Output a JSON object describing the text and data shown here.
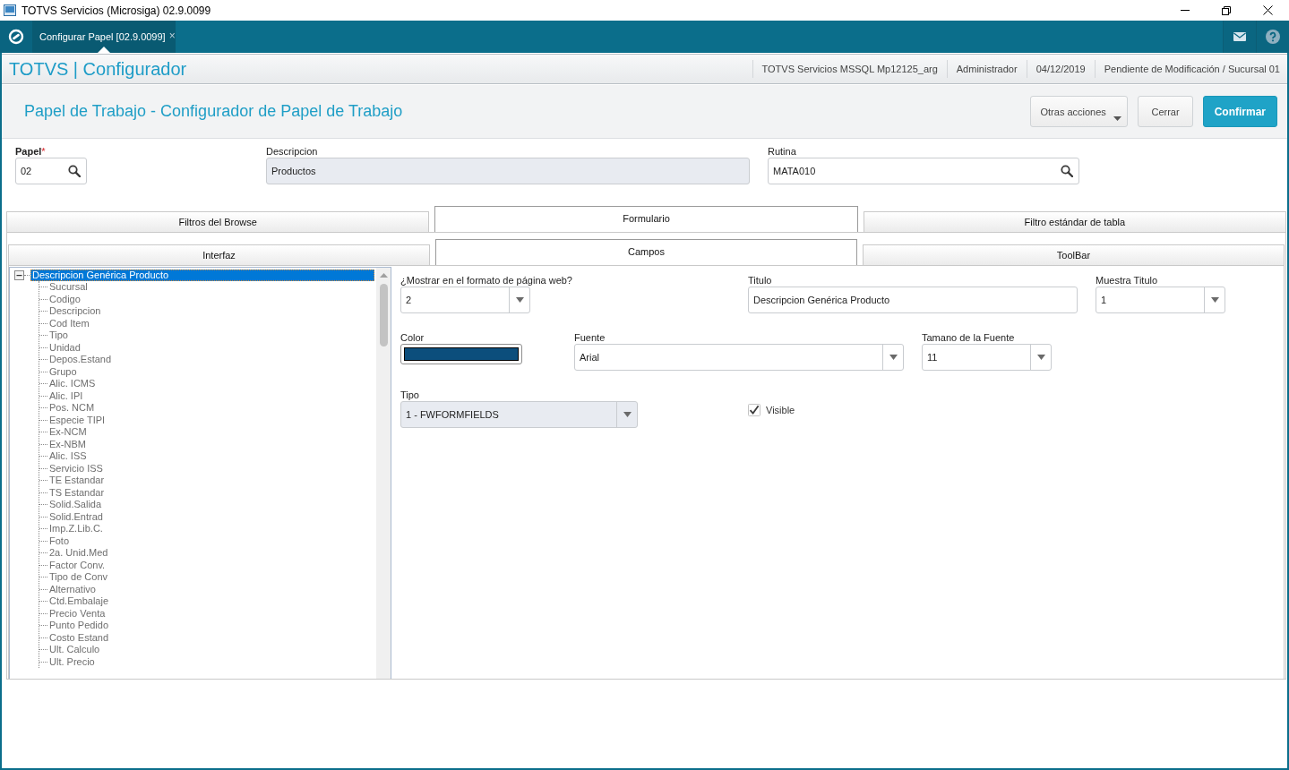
{
  "window": {
    "title": "TOTVS Servicios (Microsiga) 02.9.0099"
  },
  "app_bar": {
    "tabs": [
      {
        "label": "Configurar Papel [02.9.0099]",
        "close": "×",
        "selected": true
      }
    ]
  },
  "header": {
    "brand": "TOTVS | Configurador",
    "info": [
      "TOTVS Servicios MSSQL Mp12125_arg",
      "Administrador",
      "04/12/2019",
      "Pendiente de Modificación / Sucursal 01"
    ]
  },
  "page": {
    "title": "Papel de Trabajo - Configurador de Papel de Trabajo",
    "actions": [
      {
        "label": "Otras acciones",
        "kind": "menu"
      },
      {
        "label": "Cerrar",
        "kind": "secondary"
      },
      {
        "label": "Confirmar",
        "kind": "primary"
      }
    ]
  },
  "fields": [
    {
      "label": "Papel",
      "required_mark": "*",
      "kind": "lookup",
      "value": "02",
      "disabled": false
    },
    {
      "label": "Descripcion",
      "kind": "text",
      "value": "Productos",
      "disabled": true
    },
    {
      "label": "Rutina",
      "kind": "lookup",
      "value": "MATA010",
      "disabled": false
    }
  ],
  "tabs": [
    {
      "label": "Filtros del Browse",
      "selected": false
    },
    {
      "label": "Formulario",
      "selected": true
    },
    {
      "label": "Filtro estándar de tabla",
      "selected": false
    }
  ],
  "subtabs": [
    {
      "label": "Interfaz",
      "selected": false
    },
    {
      "label": "Campos",
      "selected": true
    },
    {
      "label": "ToolBar",
      "selected": false
    }
  ],
  "tree": {
    "items": [
      {
        "label": "Descripcion Genérica Producto",
        "selected": true,
        "expanded": true,
        "children": [
          {
            "label": "Sucursal",
            "selected": false
          },
          {
            "label": "Codigo",
            "selected": false
          },
          {
            "label": "Descripcion",
            "selected": false
          },
          {
            "label": "Cod Item",
            "selected": false
          },
          {
            "label": "Tipo",
            "selected": false
          },
          {
            "label": "Unidad",
            "selected": false
          },
          {
            "label": "Depos.Estand",
            "selected": false
          },
          {
            "label": "Grupo",
            "selected": false
          },
          {
            "label": "Alic. ICMS",
            "selected": false
          },
          {
            "label": "Alic. IPI",
            "selected": false
          },
          {
            "label": "Pos. NCM",
            "selected": false
          },
          {
            "label": "Especie TIPI",
            "selected": false
          },
          {
            "label": "Ex-NCM",
            "selected": false
          },
          {
            "label": "Ex-NBM",
            "selected": false
          },
          {
            "label": "Alic. ISS",
            "selected": false
          },
          {
            "label": "Servicio ISS",
            "selected": false
          },
          {
            "label": "TE Estandar",
            "selected": false
          },
          {
            "label": "TS Estandar",
            "selected": false
          },
          {
            "label": "Solid.Salida",
            "selected": false
          },
          {
            "label": "Solid.Entrad",
            "selected": false
          },
          {
            "label": "Imp.Z.Lib.C.",
            "selected": false
          },
          {
            "label": "Foto",
            "selected": false
          },
          {
            "label": "2a. Unid.Med",
            "selected": false
          },
          {
            "label": "Factor Conv.",
            "selected": false
          },
          {
            "label": "Tipo de Conv",
            "selected": false
          },
          {
            "label": "Alternativo",
            "selected": false
          },
          {
            "label": "Ctd.Embalaje",
            "selected": false
          },
          {
            "label": "Precio Venta",
            "selected": false
          },
          {
            "label": "Punto Pedido",
            "selected": false
          },
          {
            "label": "Costo Estand",
            "selected": false
          },
          {
            "label": "Ult. Calculo",
            "selected": false
          },
          {
            "label": "Ult. Precio",
            "selected": false
          }
        ]
      }
    ]
  },
  "form": {
    "rows": [
      [
        {
          "label": "¿Mostrar en el formato de página web?",
          "kind": "select",
          "value": "2",
          "disabled": false
        },
        {
          "label": "Titulo",
          "kind": "text",
          "value": "Descripcion Genérica Producto",
          "disabled": false
        },
        {
          "label": "Muestra Titulo",
          "kind": "select",
          "value": "1",
          "disabled": false
        }
      ],
      [
        {
          "label": "Color",
          "kind": "color",
          "color": "#0c4e7c",
          "disabled": false
        },
        {
          "label": "Fuente",
          "kind": "select",
          "value": "Arial",
          "disabled": false
        },
        {
          "label": "Tamano de la Fuente",
          "kind": "select",
          "value": "11",
          "disabled": false
        }
      ],
      [
        {
          "label": "Tipo",
          "kind": "select",
          "value": "1 - FWFORMFIELDS",
          "disabled": true
        },
        {
          "label": "Visible",
          "kind": "checkbox",
          "checked": true,
          "disabled": false
        }
      ]
    ]
  }
}
